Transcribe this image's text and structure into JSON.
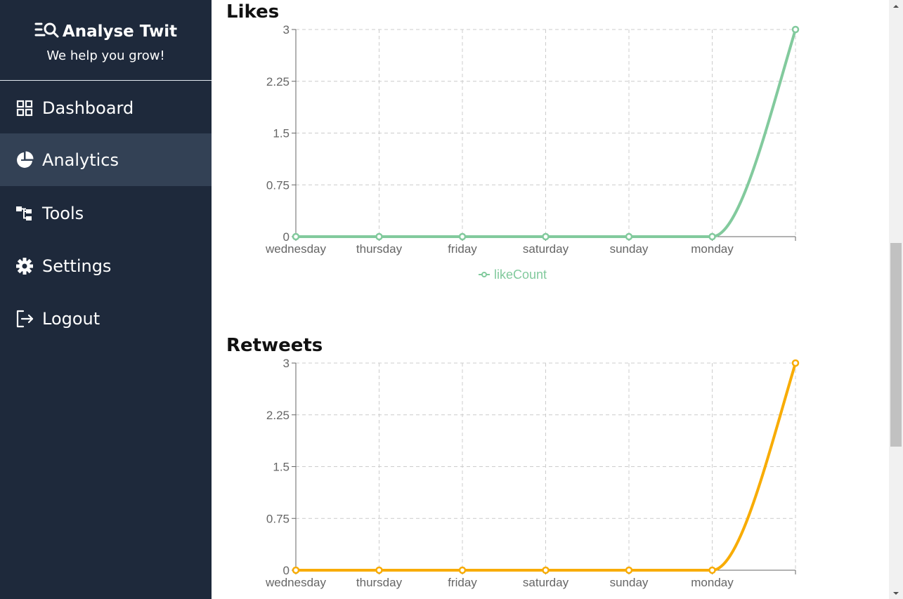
{
  "sidebar": {
    "brand": {
      "title": "Analyse Twit",
      "subtitle": "We help you grow!",
      "icon": "search-list-icon"
    },
    "items": [
      {
        "label": "Dashboard",
        "icon": "grid-icon",
        "active": false
      },
      {
        "label": "Analytics",
        "icon": "pie-chart-icon",
        "active": true
      },
      {
        "label": "Tools",
        "icon": "hierarchy-icon",
        "active": false
      },
      {
        "label": "Settings",
        "icon": "gear-icon",
        "active": false
      },
      {
        "label": "Logout",
        "icon": "logout-icon",
        "active": false
      }
    ]
  },
  "charts": {
    "likes": {
      "heading": "Likes"
    },
    "retweets": {
      "heading": "Retweets"
    }
  },
  "chart_data": [
    {
      "type": "line",
      "title": "Likes",
      "categories": [
        "wednesday",
        "thursday",
        "friday",
        "saturday",
        "sunday",
        "monday",
        ""
      ],
      "series": [
        {
          "name": "likeCount",
          "values": [
            0,
            0,
            0,
            0,
            0,
            0,
            3
          ],
          "color": "#82ca9d"
        }
      ],
      "yticks": [
        "0",
        "0.75",
        "1.5",
        "2.25",
        "3"
      ],
      "ylim": [
        0,
        3
      ],
      "grid": true,
      "legend": "bottom-center"
    },
    {
      "type": "line",
      "title": "Retweets",
      "categories": [
        "wednesday",
        "thursday",
        "friday",
        "saturday",
        "sunday",
        "monday",
        ""
      ],
      "series": [
        {
          "values": [
            0,
            0,
            0,
            0,
            0,
            0,
            3
          ],
          "color": "#f8ac04"
        }
      ],
      "yticks": [
        "0",
        "0.75",
        "1.5",
        "2.25",
        "3"
      ],
      "ylim": [
        0,
        3
      ],
      "grid": true
    }
  ],
  "colors": {
    "sidebar_bg": "#1e293b",
    "active_bg": "#334155",
    "grid": "#cccccc",
    "axis": "#666666"
  }
}
